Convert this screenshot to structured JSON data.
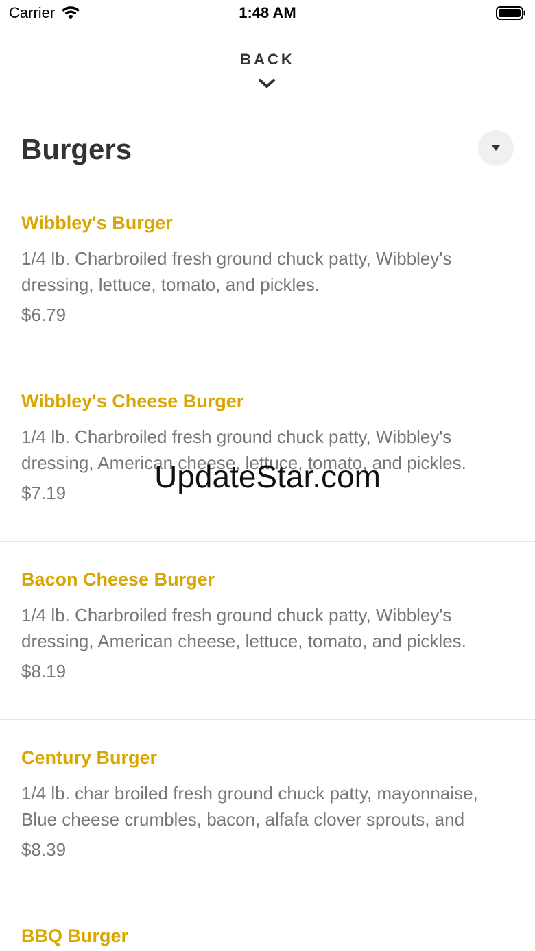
{
  "status_bar": {
    "carrier": "Carrier",
    "time": "1:48 AM"
  },
  "header": {
    "back_label": "BACK"
  },
  "category": {
    "title": "Burgers"
  },
  "menu_items": [
    {
      "name": "Wibbley's Burger",
      "description": "1/4 lb. Charbroiled fresh ground chuck patty, Wibbley's dressing, lettuce, tomato, and pickles.",
      "price": "$6.79"
    },
    {
      "name": "Wibbley's Cheese Burger",
      "description": "1/4 lb. Charbroiled fresh ground chuck patty, Wibbley's dressing, American cheese, lettuce, tomato, and pickles.",
      "price": "$7.19"
    },
    {
      "name": "Bacon Cheese Burger",
      "description": "1/4 lb. Charbroiled fresh ground chuck patty, Wibbley's dressing, American cheese, lettuce, tomato, and pickles.",
      "price": "$8.19"
    },
    {
      "name": "Century Burger",
      "description": "1/4 lb. char broiled fresh ground chuck patty, mayonnaise, Blue cheese crumbles, bacon, alfafa clover sprouts, and",
      "price": "$8.39"
    },
    {
      "name": "BBQ Burger",
      "description": "",
      "price": ""
    }
  ],
  "watermark": "UpdateStar.com",
  "colors": {
    "item_name": "#d9a500",
    "item_text": "#777777",
    "divider": "#e6e6e6"
  }
}
